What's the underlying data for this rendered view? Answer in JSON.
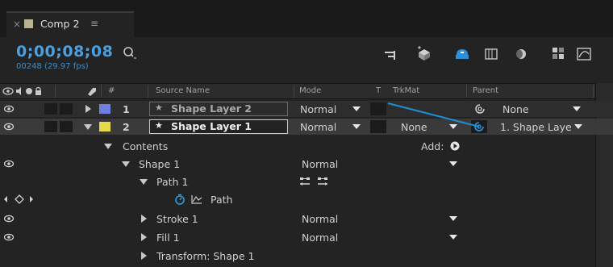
{
  "tab": {
    "close_glyph": "×",
    "title": "Comp 2",
    "menu_glyph": "≡",
    "swatch_color": "#b9b493"
  },
  "timecode": "0;00;08;08",
  "frame_info": "00248 (29.97 fps)",
  "search": {
    "placeholder": ""
  },
  "columns": {
    "hash": "#",
    "source_name": "Source Name",
    "mode": "Mode",
    "t": "T",
    "trkmat": "TrkMat",
    "parent": "Parent"
  },
  "layers": [
    {
      "index": "1",
      "name": "Shape Layer 2",
      "label_color": "#6f7fe0",
      "mode": "Normal",
      "parent": "None",
      "trkmat": ""
    },
    {
      "index": "2",
      "name": "Shape Layer 1",
      "label_color": "#e6d94a",
      "mode": "Normal",
      "trkmat": "None",
      "parent": "1. Shape Laye"
    }
  ],
  "tree": {
    "contents": "Contents",
    "add_label": "Add:",
    "shape1": "Shape 1",
    "shape1_mode": "Normal",
    "path1": "Path 1",
    "path": "Path",
    "stroke1": "Stroke 1",
    "stroke1_mode": "Normal",
    "fill1": "Fill 1",
    "fill1_mode": "Normal",
    "transform": "Transform: Shape 1"
  },
  "colors": {
    "accent": "#4aa0e0",
    "pickwhip": "#1e8fd0"
  }
}
